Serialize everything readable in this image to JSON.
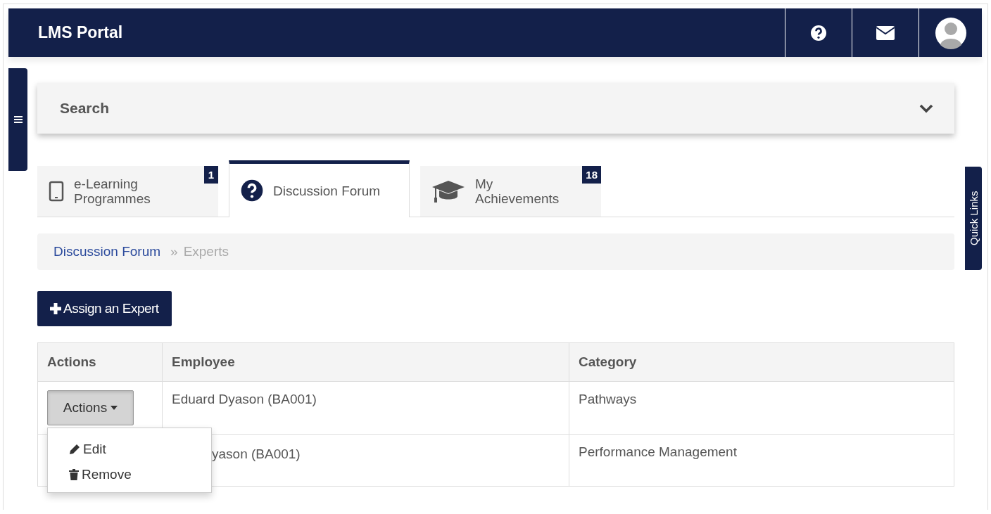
{
  "header": {
    "title": "LMS Portal"
  },
  "search": {
    "label": "Search",
    "expanded": false
  },
  "tabs": [
    {
      "label": "e-Learning Programmes",
      "kind": "tablet",
      "badge": "1",
      "selected": false
    },
    {
      "label": "Discussion Forum",
      "kind": "question",
      "selected": true
    },
    {
      "label": "My Achievements",
      "kind": "cap",
      "badge": "18",
      "selected": false
    }
  ],
  "quick_links": {
    "label": "Quick Links"
  },
  "breadcrumb": {
    "items": [
      {
        "label": "Discussion Forum",
        "kind": "link"
      },
      {
        "label": "Experts",
        "kind": "current"
      }
    ],
    "separator": "»"
  },
  "assign_button": {
    "label": "Assign an Expert"
  },
  "table": {
    "columns": [
      "Actions",
      "Employee",
      "Category"
    ],
    "rows": [
      {
        "action_button": "Actions",
        "employee": "Eduard Dyason (BA001)",
        "category": "Pathways"
      },
      {
        "employee": "yason (BA001)",
        "category": "Performance Management"
      }
    ]
  },
  "dropdown_menu": {
    "items": [
      {
        "label": "Edit",
        "kind": "edit"
      },
      {
        "label": "Remove",
        "kind": "remove"
      }
    ]
  }
}
